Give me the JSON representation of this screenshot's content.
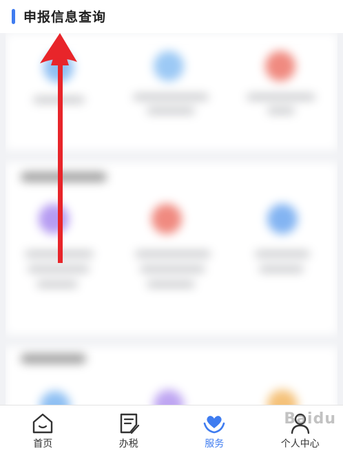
{
  "section": {
    "title": "申报信息查询"
  },
  "nav": {
    "items": [
      {
        "label": "首页",
        "icon": "home-icon"
      },
      {
        "label": "办税",
        "icon": "tax-form-icon"
      },
      {
        "label": "服务",
        "icon": "service-heart-icon"
      },
      {
        "label": "个人中心",
        "icon": "user-icon"
      }
    ],
    "active_index": 2
  },
  "watermark": {
    "text": "Baidu"
  },
  "colors": {
    "accent": "#3f7cf0",
    "arrow": "#e8252a",
    "text": "#333333"
  }
}
